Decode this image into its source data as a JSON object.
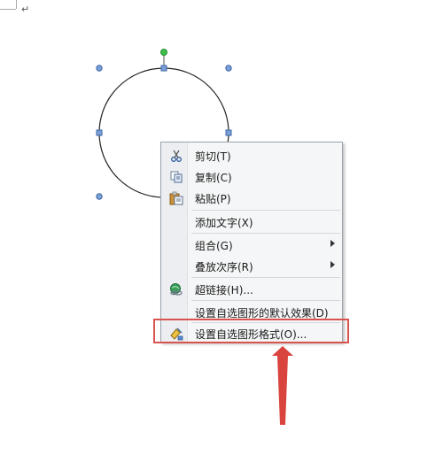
{
  "document": {
    "paragraph_mark": "↵"
  },
  "context_menu": {
    "items": [
      {
        "label": "剪切(T)",
        "icon": "scissors-icon"
      },
      {
        "label": "复制(C)",
        "icon": "copy-icon"
      },
      {
        "label": "粘贴(P)",
        "icon": "paste-icon"
      },
      {
        "label": "添加文字(X)",
        "icon": ""
      },
      {
        "label": "组合(G)",
        "icon": "",
        "submenu": true
      },
      {
        "label": "叠放次序(R)",
        "icon": "",
        "submenu": true
      },
      {
        "label": "超链接(H)...",
        "icon": "hyperlink-icon"
      },
      {
        "label": "设置自选图形的默认效果(D)",
        "icon": ""
      },
      {
        "label": "设置自选图形格式(O)...",
        "icon": "format-shape-icon",
        "highlighted": true
      }
    ]
  },
  "colors": {
    "highlight_box": "#d9534f",
    "pointer_arrow": "#d9443f",
    "rotation_handle": "#3fc24a",
    "selection_handle": "#5b8ccf"
  }
}
